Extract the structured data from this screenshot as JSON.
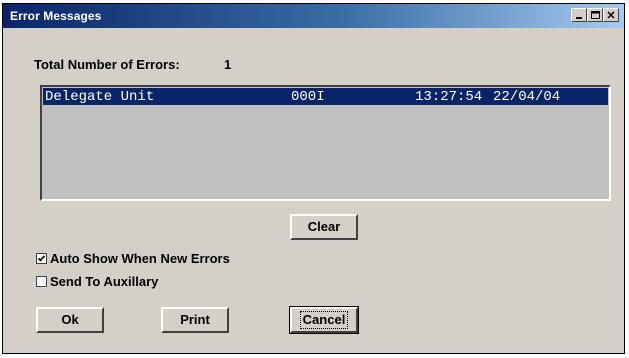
{
  "window": {
    "title": "Error Messages",
    "controls": [
      "minimize-icon",
      "maximize-icon",
      "close-icon"
    ]
  },
  "summary": {
    "label": "Total Number of Errors:",
    "count": "1"
  },
  "errors": [
    {
      "source": "Delegate Unit",
      "code": "000I",
      "time": "13:27:54",
      "date": "22/04/04",
      "selected": true
    }
  ],
  "buttons": {
    "clear": "Clear",
    "ok": "Ok",
    "print": "Print",
    "cancel": "Cancel"
  },
  "options": {
    "auto_show": {
      "label": "Auto Show When New Errors",
      "checked": true
    },
    "send_aux": {
      "label": "Send To Auxillary",
      "checked": false
    }
  },
  "colors": {
    "title_bar": "#0a246a",
    "selection": "#0a246a",
    "face": "#d4d0c8",
    "list_bg": "#c0c0c0"
  }
}
